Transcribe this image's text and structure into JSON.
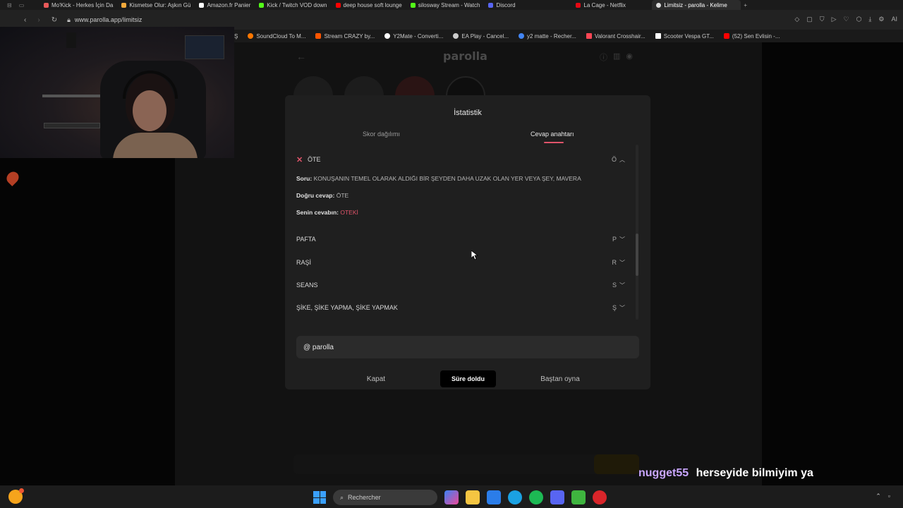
{
  "browser": {
    "tabs": [
      {
        "title": "Mo'Kick - Herkes İçin Da",
        "color": "#e85a5a"
      },
      {
        "title": "Kismetse Olur: Aşkın Gü",
        "color": "#f2a93b"
      },
      {
        "title": "Amazon.fr Panier",
        "color": "#ffffff"
      },
      {
        "title": "Kick / Twitch VOD down",
        "color": "#53fc18"
      },
      {
        "title": "deep house soft lounge",
        "color": "#ff0000"
      },
      {
        "title": "silosway Stream - Watch",
        "color": "#53fc18"
      },
      {
        "title": "Discord",
        "color": "#5865f2"
      },
      {
        "title": "La Cage - Netflix",
        "color": "#e50914"
      },
      {
        "title": "Limitsiz - parolla - Kelime",
        "color": "#dddddd",
        "active": true
      }
    ],
    "url": "www.parolla.app/limitsiz",
    "right_label": "AI",
    "bookmarks": [
      {
        "label": "Ş",
        "color": "#888888"
      },
      {
        "label": "SoundCloud To M...",
        "color": "#ff7700"
      },
      {
        "label": "Stream CRAZY by...",
        "color": "#ff5500"
      },
      {
        "label": "Y2Mate - Converti...",
        "color": "#ffffff"
      },
      {
        "label": "EA Play - Cancel...",
        "color": "#cccccc"
      },
      {
        "label": "y2 matte - Recher...",
        "color": "#4285f4"
      },
      {
        "label": "Valorant Crosshair...",
        "color": "#ff4655"
      },
      {
        "label": "Scooter Vespa GT...",
        "color": "#ffffff"
      },
      {
        "label": "(52) Sen Evlisin -...",
        "color": "#ff0000"
      }
    ]
  },
  "game": {
    "title": "parolla"
  },
  "modal": {
    "title": "İstatistik",
    "tabs": {
      "score": "Skor dağılımı",
      "answer": "Cevap anahtarı"
    },
    "expanded": {
      "word": "ÖTE",
      "letter": "Ö",
      "question_label": "Soru:",
      "question": "KONUŞANIN TEMEL OLARAK ALDIĞI BİR ŞEYDEN DAHA UZAK OLAN YER VEYA ŞEY, MAVERA",
      "correct_label": "Doğru cevap:",
      "correct": "ÖTE",
      "your_label": "Senin cevabın:",
      "your": "OTEKİ"
    },
    "rows": [
      {
        "word": "PAFTA",
        "letter": "P"
      },
      {
        "word": "RAŞİ",
        "letter": "R"
      },
      {
        "word": "SEANS",
        "letter": "S"
      },
      {
        "word": "ŞİKE, ŞİKE YAPMA, ŞİKE YAPMAK",
        "letter": "Ş"
      }
    ],
    "share": "@ parolla",
    "buttons": {
      "close": "Kapat",
      "time": "Süre doldu",
      "restart": "Baştan oyna"
    }
  },
  "chat": {
    "user": "nugget55",
    "message": "herseyide bilmiyim ya"
  },
  "taskbar": {
    "search_placeholder": "Rechercher"
  },
  "colors": {
    "accent_red": "#e0546a",
    "modal_bg": "#1f1f1f",
    "chat_user": "#c9a6ff"
  }
}
